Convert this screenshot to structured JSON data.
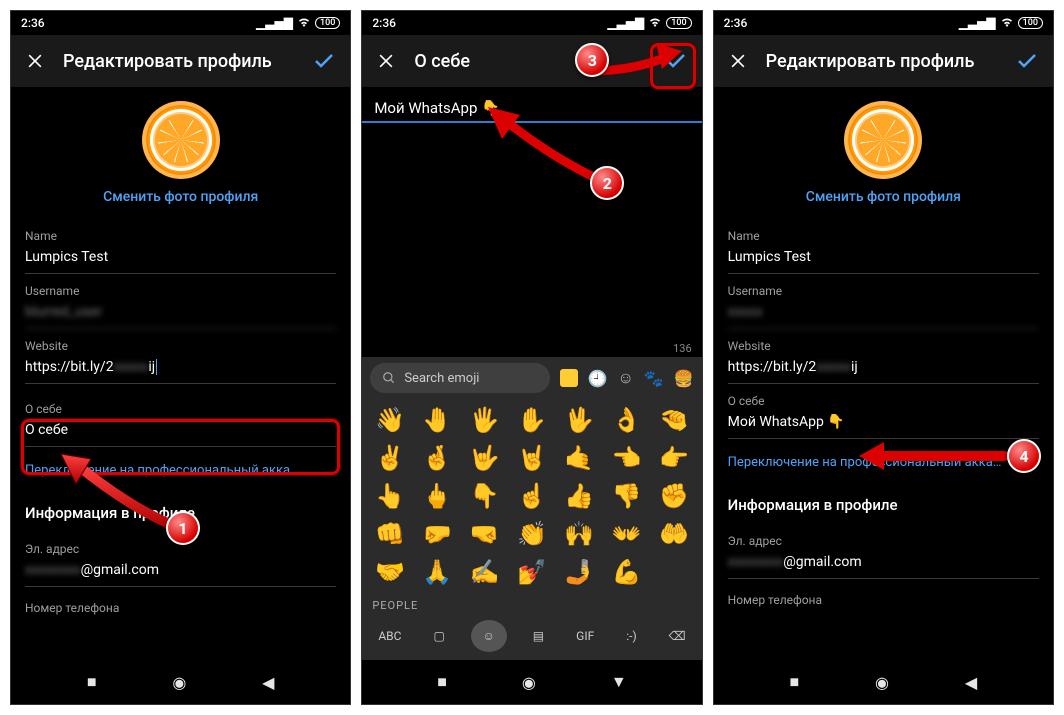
{
  "status": {
    "time": "2:36",
    "battery": "100"
  },
  "screen1": {
    "header": "Редактировать профиль",
    "change_photo": "Сменить фото профиля",
    "name_label": "Name",
    "name_value": "Lumpics Test",
    "username_label": "Username",
    "username_value": "blurred_user",
    "website_label": "Website",
    "website_prefix": "https://bit.ly/2",
    "website_suffix": "ij",
    "bio_label": "О себе",
    "bio_value": "О себе",
    "switch_link": "Переключение на профессиональный акка…",
    "info_title": "Информация в профиле",
    "email_label": "Эл. адрес",
    "email_suffix": "@gmail.com",
    "phone_label": "Номер телефона"
  },
  "screen2": {
    "header": "О себе",
    "bio_input": "Мой WhatsApp 👇",
    "char_count": "136",
    "search_placeholder": "Search emoji",
    "category_label": "PEOPLE",
    "abc_label": "ABC",
    "gif_label": "GIF",
    "emoticon_label": ":-)",
    "emoji": [
      "👋",
      "🤚",
      "🖐",
      "✋",
      "🖖",
      "👌",
      "🤏",
      "✌",
      "🤞",
      "🤟",
      "🤘",
      "🤙",
      "👈",
      "👉",
      "👆",
      "🖕",
      "👇",
      "☝",
      "👍",
      "👎",
      "✊",
      "👊",
      "🤛",
      "🤜",
      "👏",
      "🙌",
      "👐",
      "🤲",
      "🤝",
      "🙏",
      "✍",
      "💅",
      "🤳",
      "💪"
    ]
  },
  "screen3": {
    "header": "Редактировать профиль",
    "change_photo": "Сменить фото профиля",
    "name_label": "Name",
    "name_value": "Lumpics Test",
    "username_label": "Username",
    "website_label": "Website",
    "website_prefix": "https://bit.ly/2",
    "website_suffix": "ij",
    "bio_label": "О себе",
    "bio_value": "Мой WhatsApp 👇",
    "switch_link": "Переключение на профессиональный акка…",
    "info_title": "Информация в профиле",
    "email_label": "Эл. адрес",
    "email_suffix": "@gmail.com",
    "phone_label": "Номер телефона"
  },
  "annotations": {
    "n1": "1",
    "n2": "2",
    "n3": "3",
    "n4": "4"
  }
}
